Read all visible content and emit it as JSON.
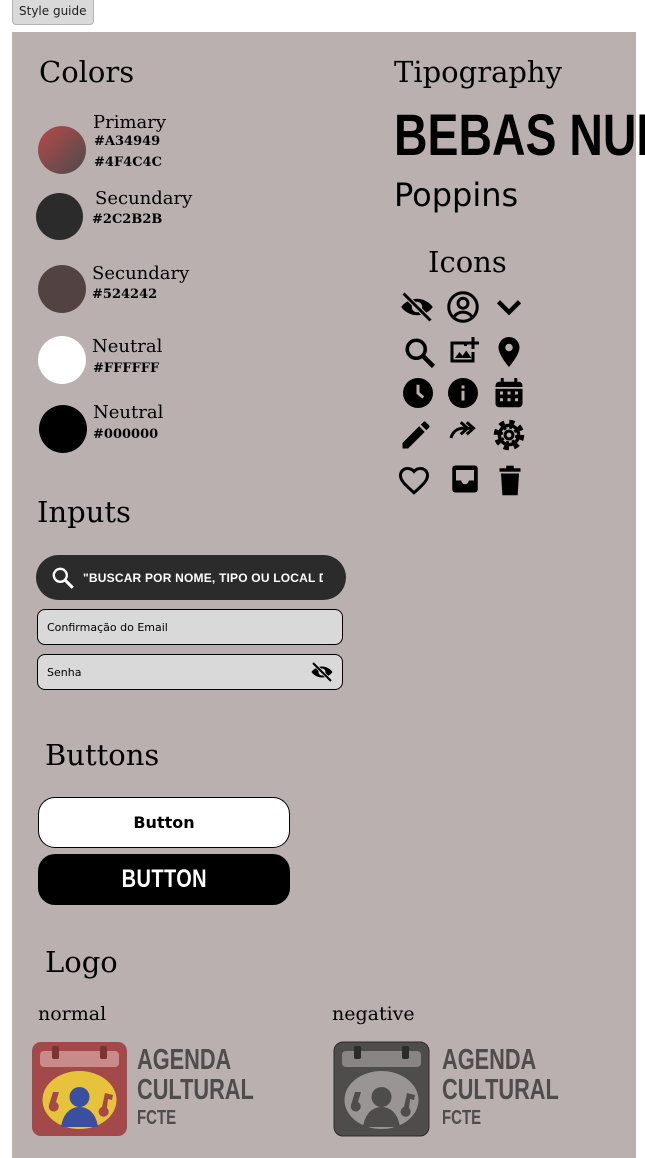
{
  "tab": {
    "label": "Style guide"
  },
  "colors": {
    "title": "Colors",
    "swatches": [
      {
        "name": "Primary",
        "hex1": "#A34949",
        "hex2": "#4F4C4C"
      },
      {
        "name": "Secundary",
        "hex1": "#2C2B2B"
      },
      {
        "name": "Secundary",
        "hex1": "#524242"
      },
      {
        "name": "Neutral",
        "hex1": "#FFFFFF"
      },
      {
        "name": "Neutral",
        "hex1": "#000000"
      }
    ]
  },
  "typography": {
    "title": "Tipography",
    "font1": "BEBAS NUE",
    "font2": "Poppins"
  },
  "icons": {
    "title": "Icons",
    "list": [
      "eye-off-icon",
      "account-circle-icon",
      "chevron-down-icon",
      "search-icon",
      "add-photo-icon",
      "location-pin-icon",
      "clock-icon",
      "info-icon",
      "calendar-icon",
      "pencil-icon",
      "share-icon",
      "gear-icon",
      "heart-icon",
      "inbox-icon",
      "trash-icon"
    ]
  },
  "inputs": {
    "title": "Inputs",
    "search_placeholder": "\"BUSCAR POR NOME, TIPO OU LOCAL DO EVENTO...\"",
    "email_placeholder": "Confirmação do Email",
    "password_placeholder": "Senha"
  },
  "buttons": {
    "title": "Buttons",
    "outline_label": "Button",
    "solid_label": "BUTTON"
  },
  "logo": {
    "title": "Logo",
    "normal_label": "normal",
    "negative_label": "negative",
    "line1": "AGENDA",
    "line2": "CULTURAL",
    "line3": "FCTE",
    "colors": {
      "normal_bg": "#A34949",
      "normal_text": "#4F4C4C",
      "negative_bg": "#4F4C4C",
      "negative_text": "#4F4C4C"
    }
  }
}
